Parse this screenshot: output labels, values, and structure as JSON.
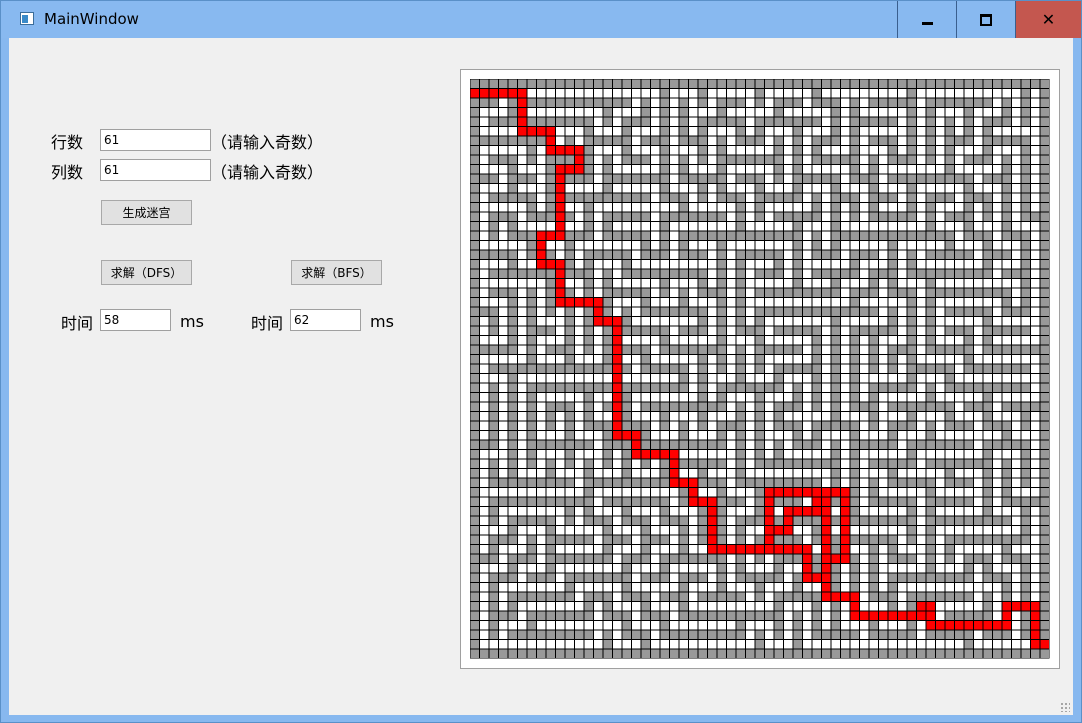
{
  "window": {
    "title": "MainWindow",
    "buttons": {
      "minimize": "minimize-icon",
      "maximize": "maximize-icon",
      "close": "✕"
    }
  },
  "form": {
    "rows_label": "行数",
    "rows_value": "61",
    "rows_hint": "（请输入奇数）",
    "cols_label": "列数",
    "cols_value": "61",
    "cols_hint": "（请输入奇数）",
    "generate_label": "生成迷宫",
    "dfs_label": "求解（DFS）",
    "bfs_label": "求解（BFS）",
    "dfs_time_label": "时间",
    "dfs_time_value": "58",
    "dfs_time_unit": "ms",
    "bfs_time_label": "时间",
    "bfs_time_value": "62",
    "bfs_time_unit": "ms"
  },
  "maze": {
    "rows": 61,
    "cols": 61,
    "colors": {
      "wall": "#999999",
      "open": "#ffffff",
      "path": "#ff0000",
      "grid": "#000000"
    },
    "path_waypoints": [
      [
        1,
        0
      ],
      [
        1,
        5
      ],
      [
        5,
        5
      ],
      [
        5,
        8
      ],
      [
        7,
        8
      ],
      [
        7,
        11
      ],
      [
        9,
        11
      ],
      [
        9,
        9
      ],
      [
        16,
        9
      ],
      [
        16,
        7
      ],
      [
        19,
        7
      ],
      [
        19,
        9
      ],
      [
        23,
        9
      ],
      [
        23,
        13
      ],
      [
        25,
        13
      ],
      [
        25,
        15
      ],
      [
        37,
        15
      ],
      [
        37,
        17
      ],
      [
        39,
        17
      ],
      [
        39,
        21
      ],
      [
        42,
        21
      ],
      [
        42,
        23
      ],
      [
        44,
        23
      ],
      [
        44,
        25
      ],
      [
        49,
        25
      ],
      [
        49,
        31
      ],
      [
        47,
        31
      ],
      [
        47,
        33
      ],
      [
        45,
        33
      ],
      [
        45,
        36
      ],
      [
        43,
        36
      ],
      [
        43,
        39
      ],
      [
        50,
        39
      ],
      [
        50,
        37
      ],
      [
        52,
        37
      ],
      [
        52,
        35
      ],
      [
        49,
        35
      ],
      [
        49,
        31
      ],
      [
        43,
        31
      ],
      [
        43,
        37
      ],
      [
        54,
        37
      ],
      [
        54,
        40
      ],
      [
        56,
        40
      ],
      [
        56,
        47
      ],
      [
        55,
        47
      ],
      [
        55,
        48
      ],
      [
        57,
        48
      ],
      [
        57,
        56
      ],
      [
        55,
        56
      ],
      [
        55,
        59
      ],
      [
        59,
        59
      ],
      [
        59,
        60
      ]
    ]
  }
}
